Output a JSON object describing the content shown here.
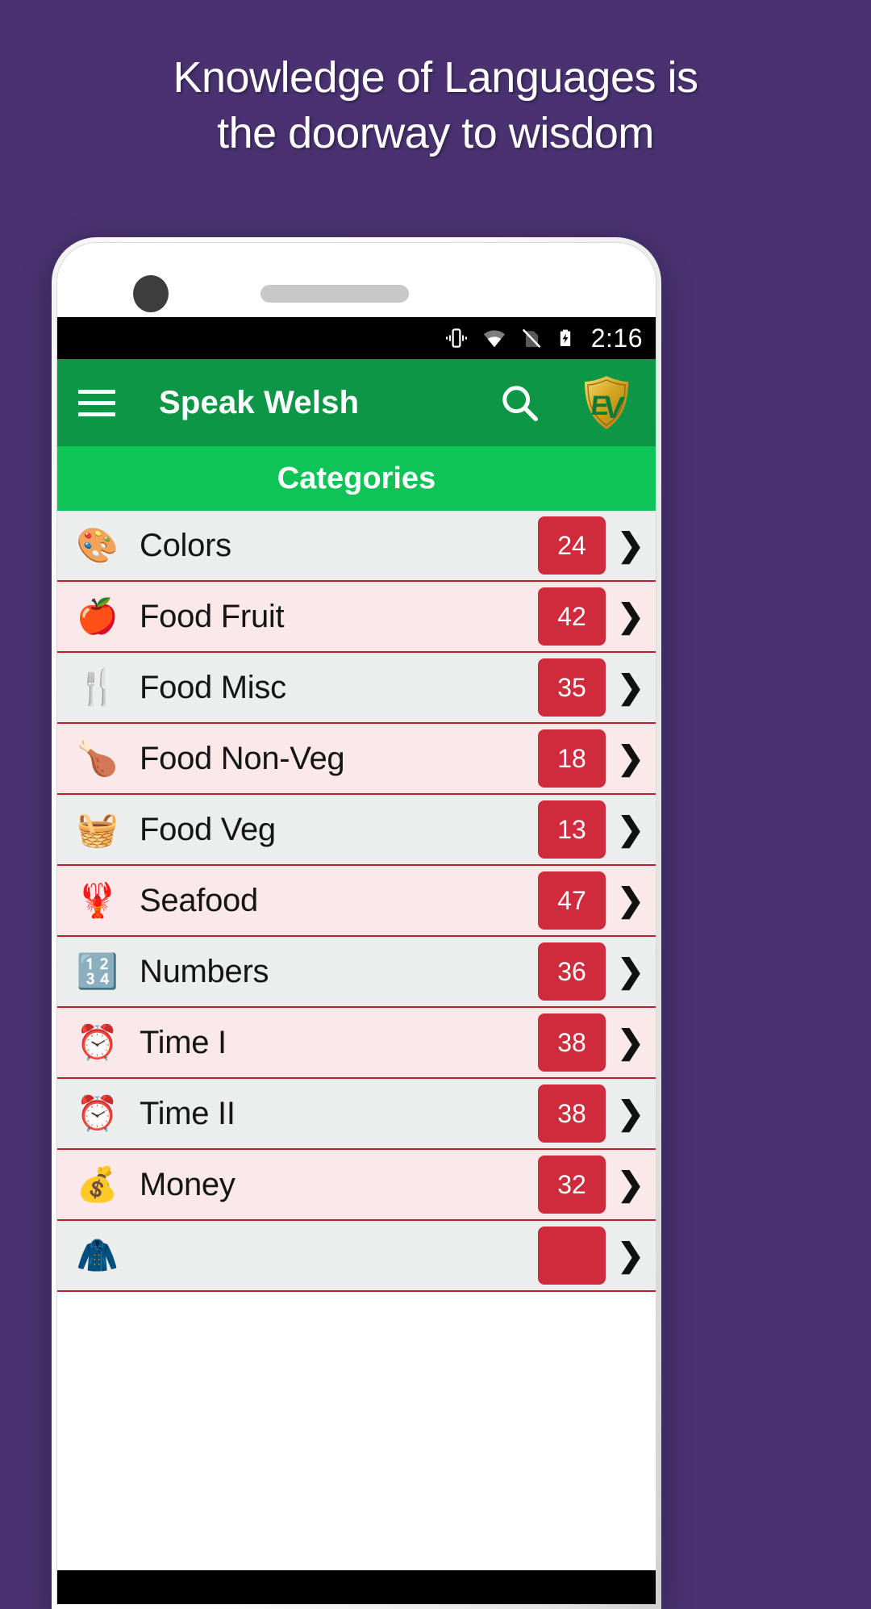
{
  "promo": {
    "headline": "Knowledge of Languages is\nthe doorway to wisdom",
    "background_color": "#4a3271",
    "text_color": "#ffffff"
  },
  "phone": {
    "camera_icon": "camera-dot",
    "speaker_icon": "earpiece-speaker"
  },
  "statusbar": {
    "background_color": "#000000",
    "icons": [
      {
        "name": "vibrate-icon",
        "label": "vibrate"
      },
      {
        "name": "wifi-icon",
        "label": "wifi"
      },
      {
        "name": "no-sim-icon",
        "label": "no sim"
      },
      {
        "name": "battery-charging-icon",
        "label": "battery charging"
      }
    ],
    "time": "2:16"
  },
  "appbar": {
    "background_color": "#0e9647",
    "menu_icon": "hamburger-menu-icon",
    "title": "Speak Welsh",
    "search_icon": "search-icon",
    "logo_icon": "ev-shield-logo",
    "logo_text": "EV",
    "logo_color": "#d4a017"
  },
  "section": {
    "title": "Categories",
    "background_color": "#0ec457"
  },
  "list": {
    "badge_color": "#cf2b3c",
    "row_even_color": "#eceded",
    "row_odd_color": "#fbe9ea",
    "divider_color": "#b5212f",
    "chevron_glyph": "❯",
    "items": [
      {
        "icon": "🎨",
        "icon_name": "palette-icon",
        "label": "Colors",
        "count": "24"
      },
      {
        "icon": "🍎",
        "icon_name": "apple-icon",
        "label": "Food Fruit",
        "count": "42"
      },
      {
        "icon": "🍴",
        "icon_name": "fork-knife-icon",
        "label": "Food Misc",
        "count": "35"
      },
      {
        "icon": "🍗",
        "icon_name": "poultry-leg-icon",
        "label": "Food Non-Veg",
        "count": "18"
      },
      {
        "icon": "🧺",
        "icon_name": "veg-basket-icon",
        "label": "Food Veg",
        "count": "13"
      },
      {
        "icon": "🦞",
        "icon_name": "seafood-icon",
        "label": "Seafood",
        "count": "47"
      },
      {
        "icon": "🔢",
        "icon_name": "numbers-123-icon",
        "label": "Numbers",
        "count": "36"
      },
      {
        "icon": "⏰",
        "icon_name": "alarm-clock-icon",
        "label": "Time I",
        "count": "38"
      },
      {
        "icon": "⏰",
        "icon_name": "alarm-clock-icon",
        "label": "Time II",
        "count": "38"
      },
      {
        "icon": "💰",
        "icon_name": "money-bag-icon",
        "label": "Money",
        "count": "32"
      },
      {
        "icon": "🧥",
        "icon_name": "clothing-icon",
        "label": "",
        "count": ""
      }
    ]
  }
}
